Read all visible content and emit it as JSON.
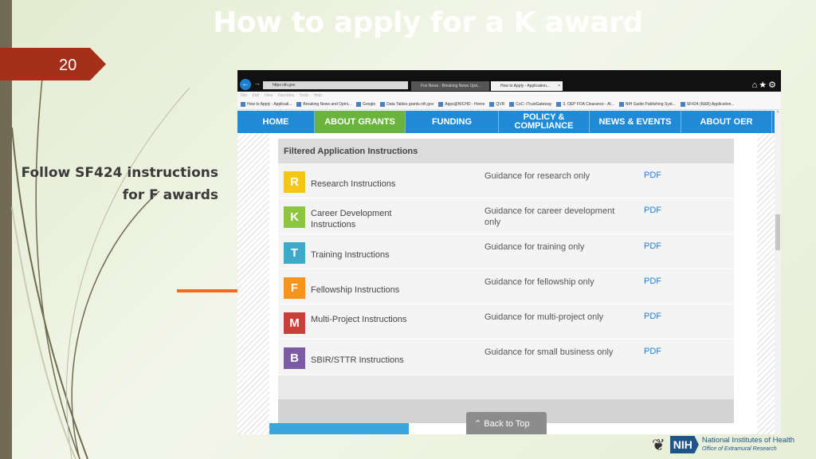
{
  "slide": {
    "title": "How to apply for a K award",
    "number": "20",
    "side_text_line1": "Follow SF424 instructions",
    "side_text_line2": "for F awards",
    "accent": "#a5301a",
    "arrow_color": "#f26a1b"
  },
  "browser": {
    "address": "https  nih.gov",
    "tabs": [
      "Fox News - Breaking News Upd...",
      "How to Apply - Application..."
    ],
    "menu": "File Edit View Favorites Tools Help",
    "favorites": [
      "How to Apply - Applicati...",
      "Breaking News and Opini...",
      "Google",
      "Data Tables  grants.nih.gov",
      "Apps@NICHD - Home",
      "QVR",
      "CoC- iTrustGateway",
      "3. OEP FOA Clearance - Al...",
      "NIH Guide Publishing Syst...",
      "SF424 (R&R) Application..."
    ]
  },
  "nav": [
    {
      "label": "HOME"
    },
    {
      "label": "ABOUT GRANTS",
      "active": true
    },
    {
      "label": "FUNDING"
    },
    {
      "label": "POLICY & COMPLIANCE"
    },
    {
      "label": "NEWS & EVENTS"
    },
    {
      "label": "ABOUT OER"
    }
  ],
  "panel": {
    "header": "Filtered Application Instructions",
    "rows": [
      {
        "letter": "R",
        "color": "#f5c518",
        "name": "Research Instructions",
        "guide": "Guidance for research only",
        "link": "PDF"
      },
      {
        "letter": "K",
        "color": "#8cc63f",
        "name": "Career Development Instructions",
        "guide": "Guidance for career development only",
        "link": "PDF"
      },
      {
        "letter": "T",
        "color": "#3fa9c9",
        "name": "Training Instructions",
        "guide": "Guidance for training only",
        "link": "PDF"
      },
      {
        "letter": "F",
        "color": "#f7941d",
        "name": "Fellowship Instructions",
        "guide": "Guidance for fellowship only",
        "link": "PDF"
      },
      {
        "letter": "M",
        "color": "#c9403a",
        "name": "Multi-Project Instructions",
        "guide": "Guidance for multi-project only",
        "link": "PDF"
      },
      {
        "letter": "B",
        "color": "#7b5aa6",
        "name": "SBIR/STTR Instructions",
        "guide": "Guidance for small business only",
        "link": "PDF"
      }
    ]
  },
  "back_to_top": "Back to Top",
  "logo": {
    "nih": "NIH",
    "name": "National Institutes of Health",
    "office": "Office of Extramural Research"
  }
}
